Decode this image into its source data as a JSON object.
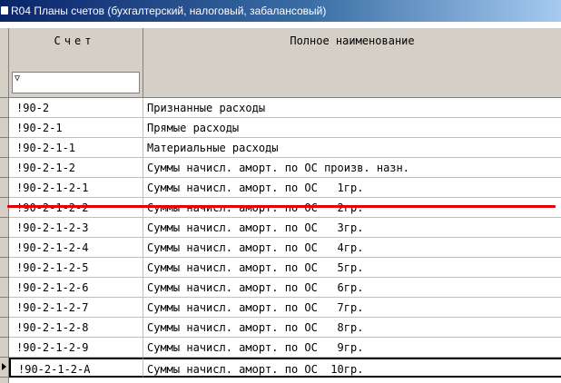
{
  "window": {
    "title": "R04 Планы счетов (бухгалтерский, налоговый, забалансовый)"
  },
  "grid": {
    "columns": {
      "account": "Счет",
      "full_name": "Полное наименование"
    },
    "filter_value": "",
    "rows": [
      {
        "account": "!90-2",
        "name": "Признанные расходы"
      },
      {
        "account": "!90-2-1",
        "name": "Прямые расходы"
      },
      {
        "account": "!90-2-1-1",
        "name": "Материальные расходы"
      },
      {
        "account": "!90-2-1-2",
        "name": "Суммы начисл. аморт. по ОС произв. назн."
      },
      {
        "account": "!90-2-1-2-1",
        "name": "Суммы начисл. аморт. по ОС   1гр."
      },
      {
        "account": "!90-2-1-2-2",
        "name": "Суммы начисл. аморт. по ОС   2гр."
      },
      {
        "account": "!90-2-1-2-3",
        "name": "Суммы начисл. аморт. по ОС   3гр."
      },
      {
        "account": "!90-2-1-2-4",
        "name": "Суммы начисл. аморт. по ОС   4гр."
      },
      {
        "account": "!90-2-1-2-5",
        "name": "Суммы начисл. аморт. по ОС   5гр."
      },
      {
        "account": "!90-2-1-2-6",
        "name": "Суммы начисл. аморт. по ОС   6гр."
      },
      {
        "account": "!90-2-1-2-7",
        "name": "Суммы начисл. аморт. по ОС   7гр."
      },
      {
        "account": "!90-2-1-2-8",
        "name": "Суммы начисл. аморт. по ОС   8гр."
      },
      {
        "account": "!90-2-1-2-9",
        "name": "Суммы начисл. аморт. по ОС   9гр."
      },
      {
        "account": "!90-2-1-2-А",
        "name": "Суммы начисл. аморт. по ОС  10гр."
      }
    ],
    "current_row": 13,
    "highlight_color": "#e00000"
  }
}
